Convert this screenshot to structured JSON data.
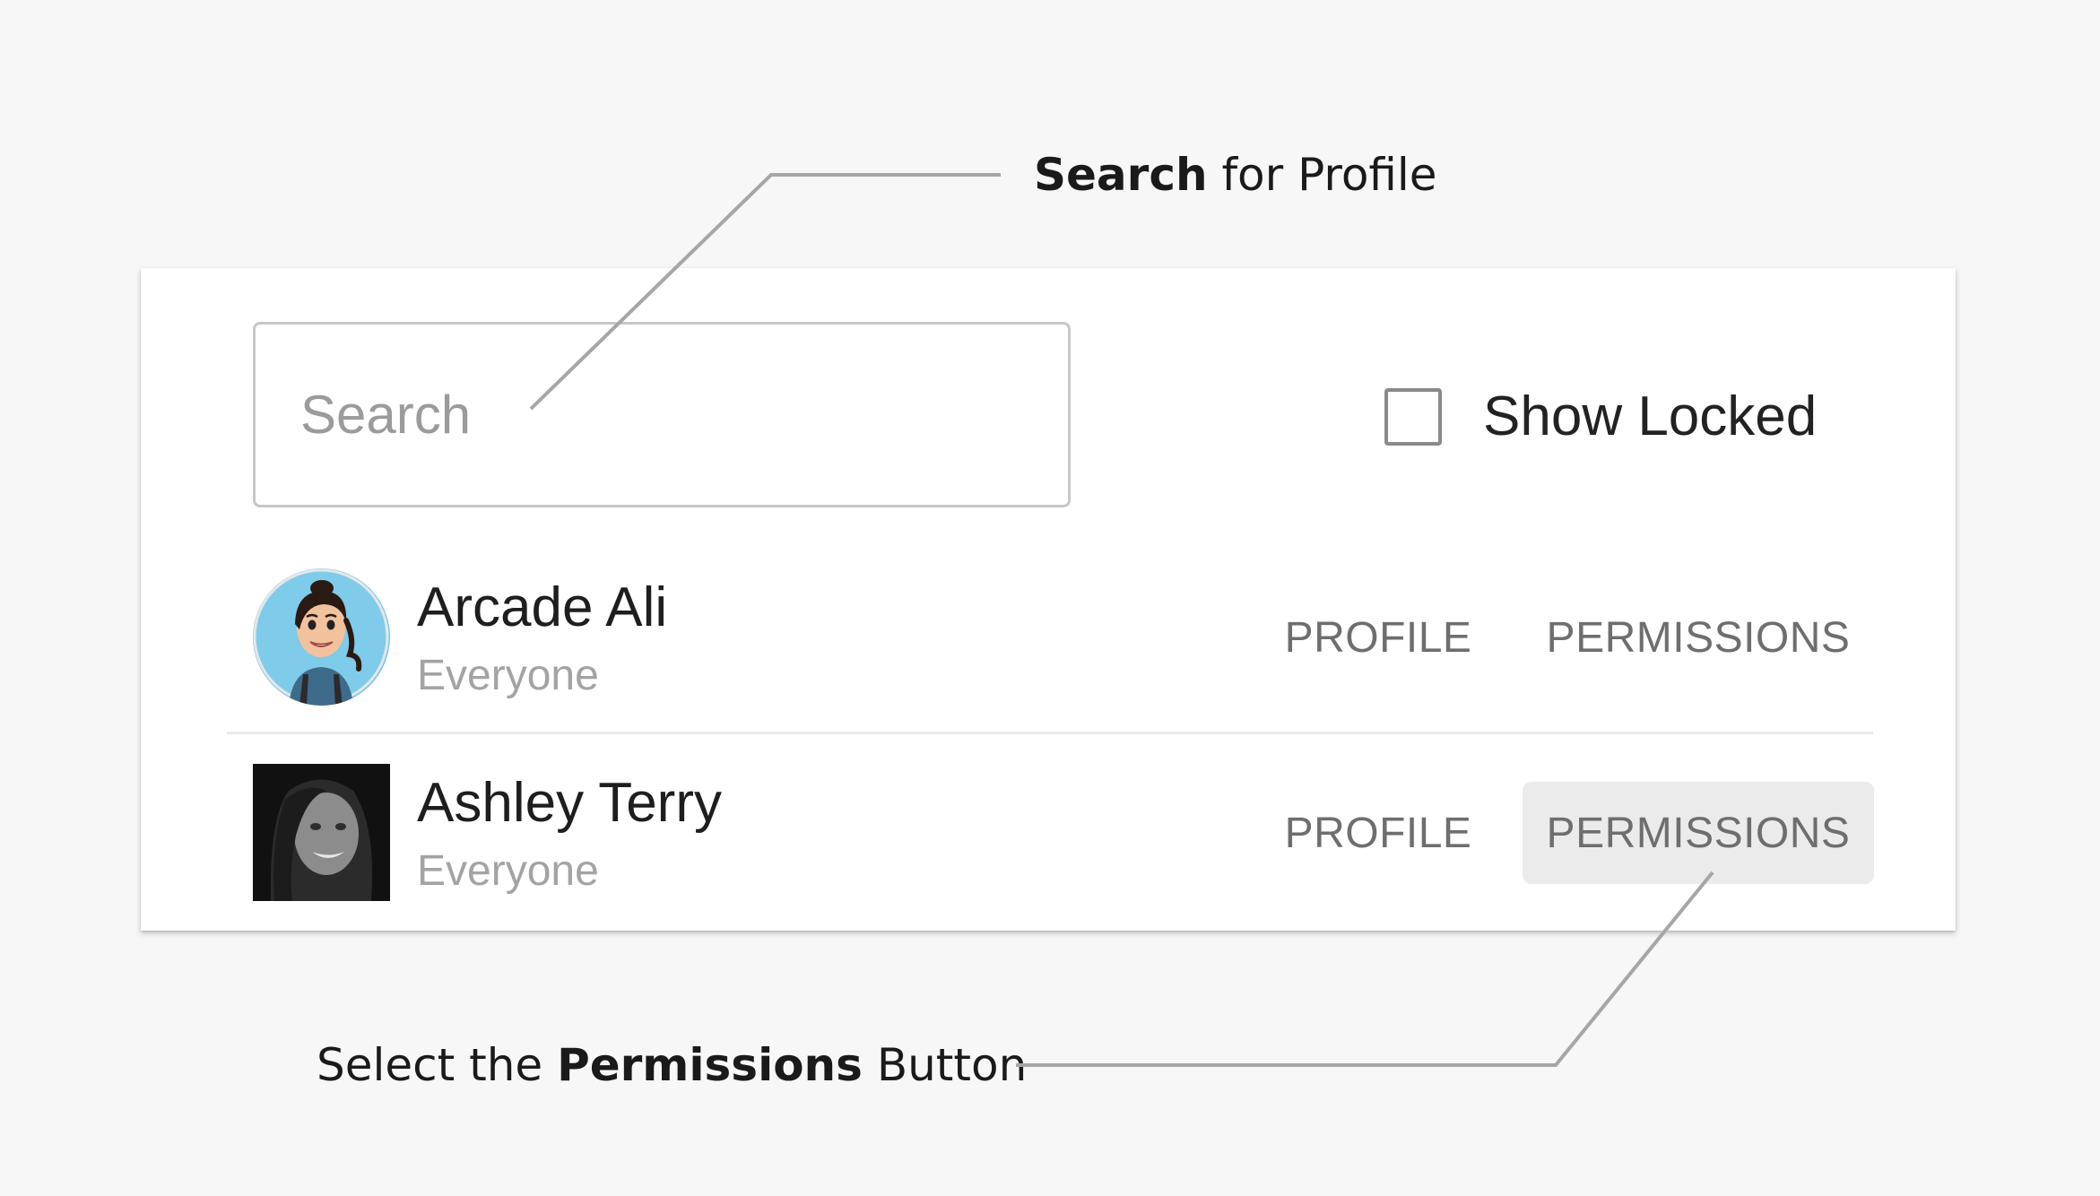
{
  "callouts": {
    "search": {
      "bold": "Search",
      "rest": " for Profile"
    },
    "permissions": {
      "pre": "Select the ",
      "bold": "Permissions",
      "post": " Button"
    }
  },
  "search": {
    "placeholder": "Search",
    "value": ""
  },
  "show_locked": {
    "label": "Show Locked",
    "checked": false
  },
  "users": [
    {
      "name": "Arcade Ali",
      "group": "Everyone",
      "avatar": "cartoon-avatar",
      "profile_label": "PROFILE",
      "permissions_label": "PERMISSIONS"
    },
    {
      "name": "Ashley Terry",
      "group": "Everyone",
      "avatar": "photo-avatar",
      "profile_label": "PROFILE",
      "permissions_label": "PERMISSIONS"
    }
  ],
  "colors": {
    "page_bg": "#f7f7f7",
    "card_bg": "#ffffff",
    "connector": "#a6a6a6",
    "button_text": "#6e6e6e",
    "button_hover_bg": "#ebebeb"
  }
}
